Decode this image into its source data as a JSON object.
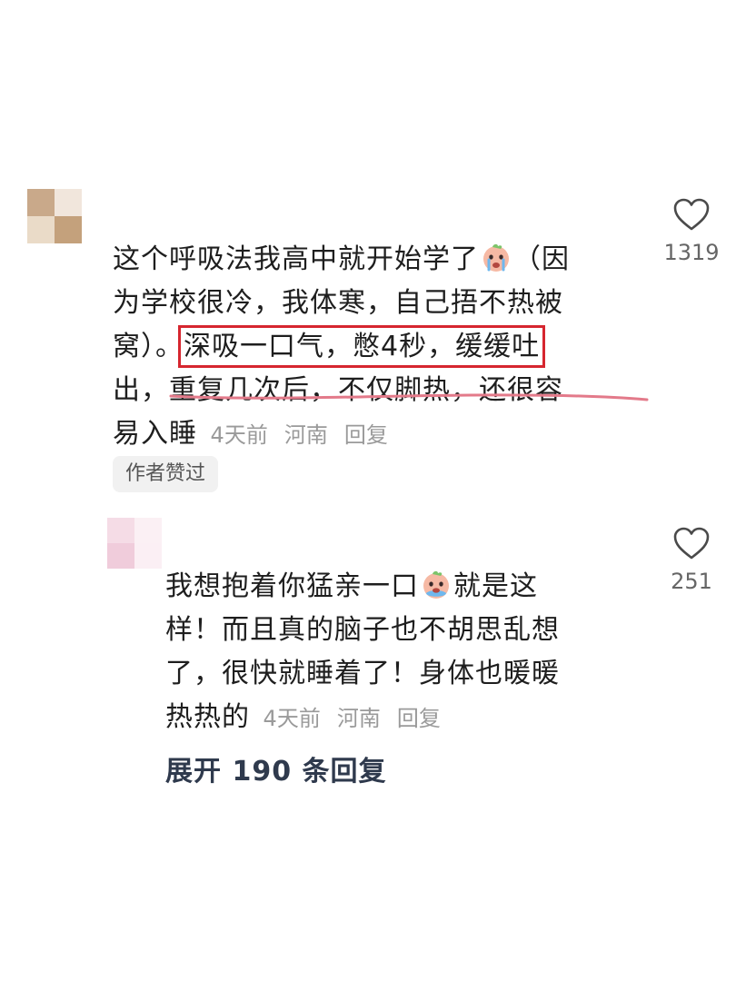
{
  "comments": [
    {
      "lines": {
        "l1": "这个呼吸法我高中就开始学了",
        "l1b": "（因",
        "l2": "为学校很冷，我体寒，自己捂不热被",
        "l3a": "窝）。",
        "l3b": "深吸一口气，憋4秒，缓缓吐",
        "l4a": "出，",
        "l4b": "重复几次后，不仅脚热，还很容",
        "l5": "易入睡"
      },
      "time": "4天前",
      "location": "河南",
      "reply": "回复",
      "badge": "作者赞过",
      "likes": "1319",
      "emoji_icon": "crying-face-icon"
    },
    {
      "lines": {
        "l1a": "我想抱着你猛亲一口",
        "l1b": "就是这",
        "l2": "样！而且真的脑子也不胡思乱想",
        "l3": "了，很快就睡着了！身体也暖暖",
        "l4": "热热的"
      },
      "time": "4天前",
      "location": "河南",
      "reply": "回复",
      "likes": "251",
      "emoji_icon": "crying-face-icon"
    }
  ],
  "expand_replies": "展开 190 条回复",
  "colors": {
    "highlight_box": "#d6262f",
    "underline": "#e37a8a",
    "meta_text": "#9a9a9a",
    "expand_text": "#2f3a4d"
  }
}
